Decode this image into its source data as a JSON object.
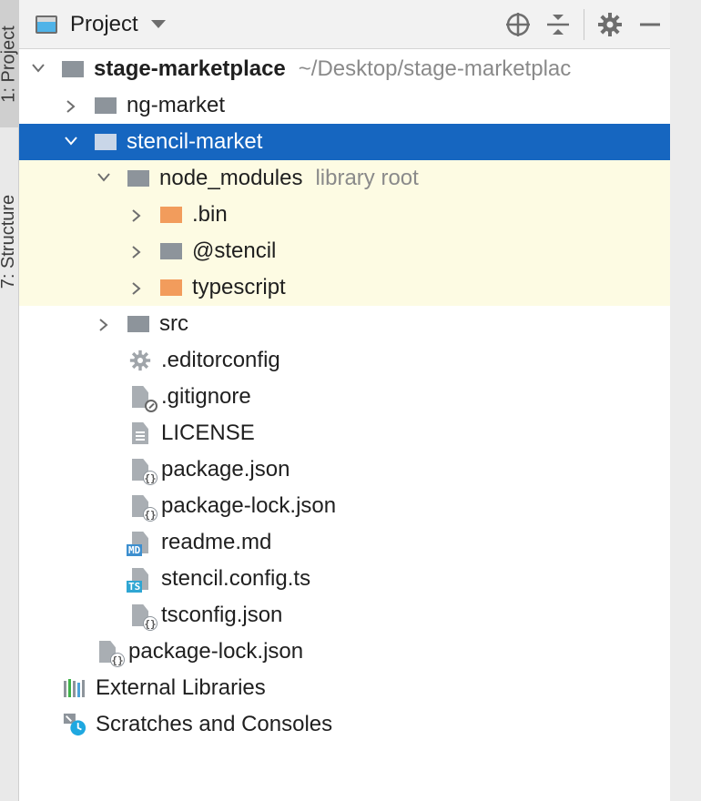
{
  "side_stripe": {
    "tabs": [
      {
        "label": "1: Project"
      },
      {
        "label": "7: Structure"
      }
    ]
  },
  "header": {
    "title": "Project",
    "tools": [
      "locate-icon",
      "collapse-all-icon",
      "gear-icon",
      "hide-icon"
    ]
  },
  "tree": [
    {
      "label": "stage-marketplace",
      "hint": "~/Desktop/stage-marketplac",
      "icon": "folder-grey",
      "arrow": "down"
    },
    {
      "label": "ng-market",
      "icon": "folder-grey",
      "arrow": "right"
    },
    {
      "label": "stencil-market",
      "icon": "folder-white",
      "arrow": "down"
    },
    {
      "label": "node_modules",
      "hint": "library root",
      "icon": "folder-grey",
      "arrow": "down"
    },
    {
      "label": ".bin",
      "icon": "folder-orange",
      "arrow": "right"
    },
    {
      "label": "@stencil",
      "icon": "folder-grey",
      "arrow": "right"
    },
    {
      "label": "typescript",
      "icon": "folder-orange",
      "arrow": "right"
    },
    {
      "label": "src",
      "icon": "folder-grey",
      "arrow": "right"
    },
    {
      "label": ".editorconfig",
      "icon": "gear-icon"
    },
    {
      "label": ".gitignore",
      "icon": "ignore-file-icon"
    },
    {
      "label": "LICENSE",
      "icon": "text-file-icon"
    },
    {
      "label": "package.json",
      "icon": "json-file-icon"
    },
    {
      "label": "package-lock.json",
      "icon": "json-file-icon"
    },
    {
      "label": "readme.md",
      "icon": "markdown-file-icon",
      "badge": "MD"
    },
    {
      "label": "stencil.config.ts",
      "icon": "typescript-file-icon",
      "badge": "TS"
    },
    {
      "label": "tsconfig.json",
      "icon": "json-file-icon"
    },
    {
      "label": "package-lock.json",
      "icon": "json-file-icon"
    },
    {
      "label": "External Libraries",
      "icon": "library-icon"
    },
    {
      "label": "Scratches and Consoles",
      "icon": "scratches-icon"
    }
  ],
  "colors": {
    "selection": "#1666c0",
    "library_root_bg": "#fdfbe3",
    "excluded_folder": "#f29c5c"
  }
}
